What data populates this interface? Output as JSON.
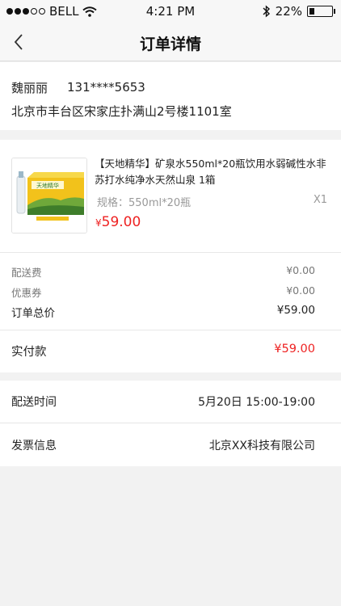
{
  "status_bar": {
    "carrier": "BELL",
    "time": "4:21 PM",
    "battery": "22%",
    "battery_level": 0.22
  },
  "nav": {
    "title": "订单详情"
  },
  "address": {
    "name": "魏丽丽",
    "phone": "131****5653",
    "detail": "北京市丰台区宋家庄扑满山2号楼1101室"
  },
  "product": {
    "name": "【天地精华】矿泉水550ml*20瓶饮用水弱碱性水非苏打水纯净水天然山泉 1箱",
    "spec": "规格：550ml*20瓶",
    "qty": "X1",
    "currency": "¥",
    "price": "59.00",
    "image_brand": "天地精华"
  },
  "fees": {
    "shipping_label": "配送费",
    "shipping_value": "¥0.00",
    "coupon_label": "优惠券",
    "coupon_value": "¥0.00",
    "total_label": "订单总价",
    "total_value": "¥59.00"
  },
  "payment": {
    "label": "实付款",
    "value": "¥59.00"
  },
  "delivery": {
    "label": "配送时间",
    "value": "5月20日 15:00-19:00"
  },
  "invoice": {
    "label": "发票信息",
    "value": "北京XX科技有限公司"
  },
  "colors": {
    "accent": "#e22222",
    "background": "#f2f2f2"
  }
}
